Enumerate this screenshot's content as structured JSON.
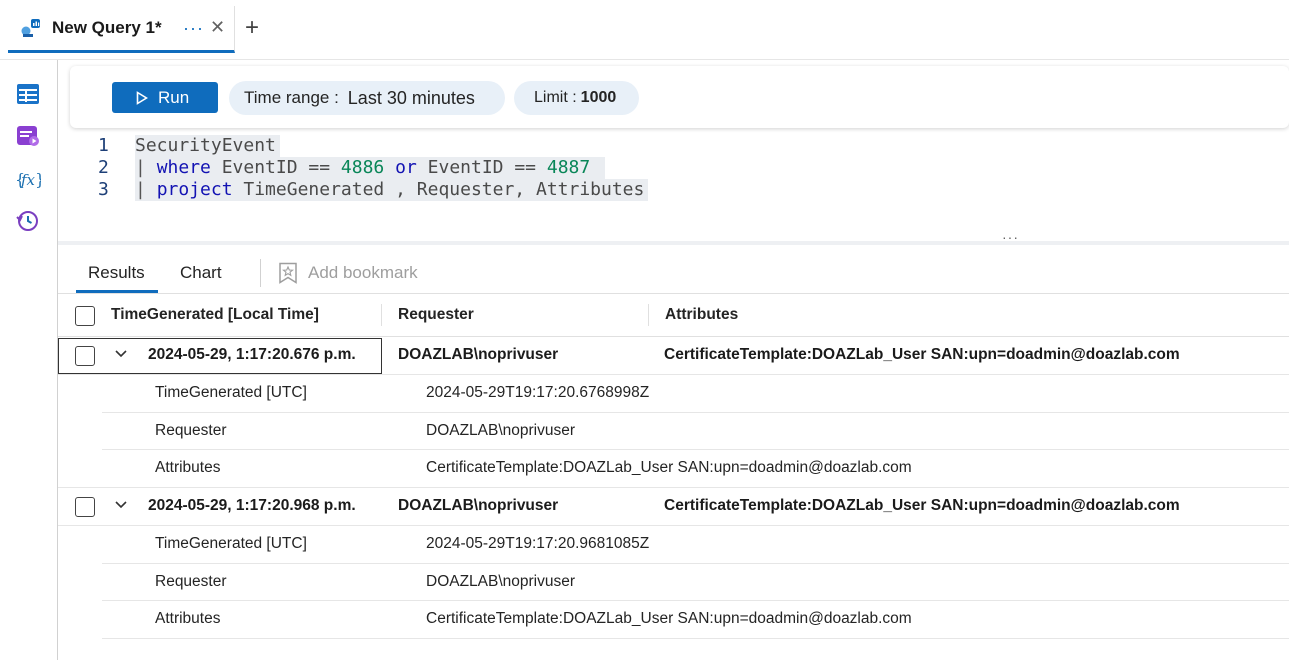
{
  "tab": {
    "title": "New Query 1*",
    "more": "···",
    "close": "✕",
    "add": "+"
  },
  "rail": {
    "icons": [
      "tables-icon",
      "queries-icon",
      "functions-icon",
      "history-icon"
    ]
  },
  "toolbar": {
    "run_label": "Run",
    "time_range_label": "Time range :",
    "time_range_value": "Last 30 minutes",
    "limit_label": "Limit :",
    "limit_value": "1000"
  },
  "code": {
    "line_numbers": [
      "1",
      "2",
      "3"
    ],
    "line1": "SecurityEvent",
    "line2": {
      "pipe": "| ",
      "kw1": "where",
      "a": " EventID == ",
      "n1": "4886",
      "b": " ",
      "kw2": "or",
      "c": " EventID == ",
      "n2": "4887",
      "d": " "
    },
    "line3": {
      "pipe": "| ",
      "kw": "project",
      "rest": " TimeGenerated , Requester, Attributes"
    }
  },
  "results": {
    "tabs": [
      "Results",
      "Chart"
    ],
    "bookmark_label": "Add bookmark",
    "columns": [
      "TimeGenerated [Local Time]",
      "Requester",
      "Attributes"
    ],
    "rows": [
      {
        "time_local": "2024-05-29, 1:17:20.676 p.m.",
        "requester": "DOAZLAB\\noprivuser",
        "attributes": "CertificateTemplate:DOAZLab_User SAN:upn=doadmin@doazlab.com",
        "details": [
          {
            "key": "TimeGenerated [UTC]",
            "value": "2024-05-29T19:17:20.6768998Z"
          },
          {
            "key": "Requester",
            "value": "DOAZLAB\\noprivuser"
          },
          {
            "key": "Attributes",
            "value": "CertificateTemplate:DOAZLab_User SAN:upn=doadmin@doazlab.com"
          }
        ]
      },
      {
        "time_local": "2024-05-29, 1:17:20.968 p.m.",
        "requester": "DOAZLAB\\noprivuser",
        "attributes": "CertificateTemplate:DOAZLab_User SAN:upn=doadmin@doazlab.com",
        "details": [
          {
            "key": "TimeGenerated [UTC]",
            "value": "2024-05-29T19:17:20.9681085Z"
          },
          {
            "key": "Requester",
            "value": "DOAZLAB\\noprivuser"
          },
          {
            "key": "Attributes",
            "value": "CertificateTemplate:DOAZLab_User SAN:upn=doadmin@doazlab.com"
          }
        ]
      }
    ]
  },
  "colors": {
    "accent": "#0f6cbd",
    "pill_bg": "#e8f0f8",
    "number": "#098658",
    "keyword": "#1313b3"
  }
}
